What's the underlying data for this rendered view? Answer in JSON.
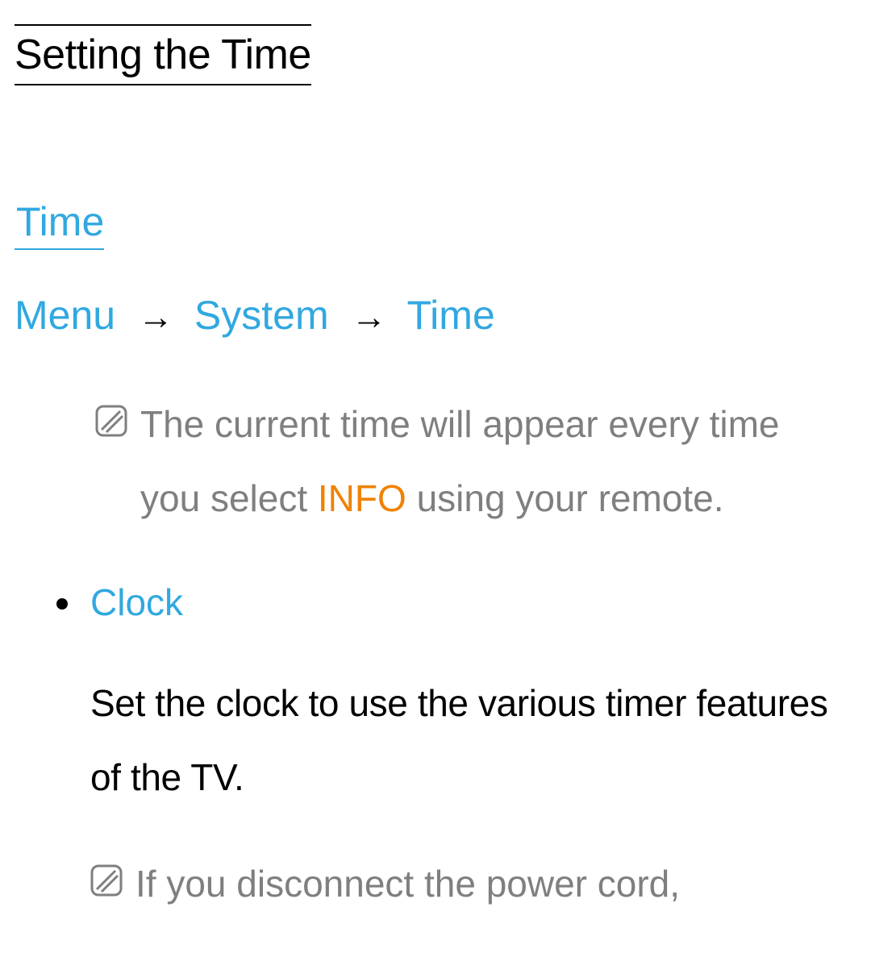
{
  "title": "Setting the Time",
  "section_label": "Time",
  "breadcrumb": {
    "items": [
      "Menu",
      "System",
      "Time"
    ],
    "arrow": "→"
  },
  "note1": {
    "pre": "The current time will appear every time you select ",
    "keyword": "INFO",
    "post": " using your remote."
  },
  "bullet": {
    "title": "Clock",
    "desc": "Set the clock to use the various timer features of the TV."
  },
  "note2": {
    "text": "If you disconnect the power cord,"
  }
}
